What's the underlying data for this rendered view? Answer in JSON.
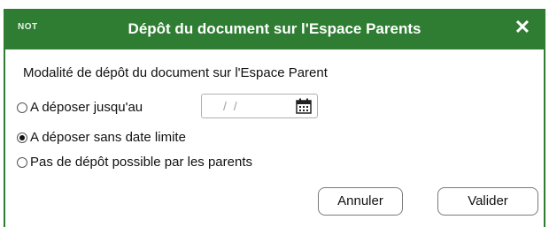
{
  "dialog": {
    "logo_text": "NOT",
    "title": "Dépôt du document sur l'Espace Parents",
    "close_icon": "close-icon",
    "close_glyph": "✕"
  },
  "section_label": "Modalité de dépôt du document sur l'Espace Parent",
  "options": [
    {
      "label": "A déposer jusqu'au",
      "checked": false
    },
    {
      "label": "A déposer sans date limite",
      "checked": true
    },
    {
      "label": "Pas de dépôt possible par les parents",
      "checked": false
    }
  ],
  "date_field": {
    "value": "/ /",
    "icon": "calendar-icon"
  },
  "buttons": {
    "cancel_label": "Annuler",
    "ok_label": "Valider"
  },
  "colors": {
    "title_bar": "#2e7d32",
    "title_text": "#ffffff"
  }
}
